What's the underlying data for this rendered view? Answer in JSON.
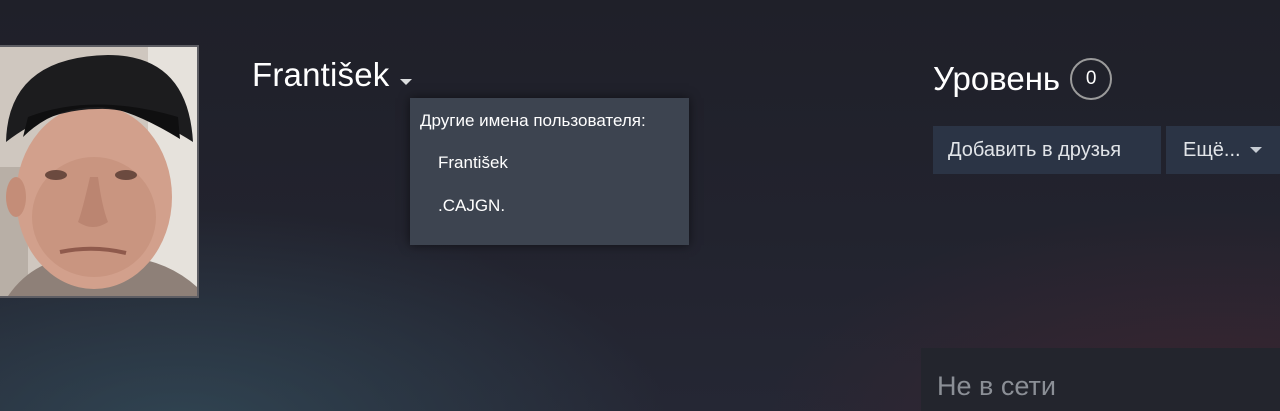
{
  "profile": {
    "avatar_icon": "user-avatar-photo",
    "persona_name": "František",
    "persona_caret_icon": "caret-down-icon"
  },
  "alias_menu": {
    "title": "Другие имена пользователя:",
    "items": [
      "František",
      ".CAJGN."
    ]
  },
  "level": {
    "label": "Уровень",
    "value": "0"
  },
  "actions": {
    "add_friend_label": "Добавить в друзья",
    "more_label": "Ещё...",
    "more_caret_icon": "caret-down-icon"
  },
  "status": {
    "text": "Не в сети"
  },
  "colors": {
    "background": "#22232e",
    "dropdown_bg": "#3d4450",
    "button_bg": "#2b3445",
    "status_panel_bg": "#23252d",
    "status_text": "#8b8f96"
  }
}
